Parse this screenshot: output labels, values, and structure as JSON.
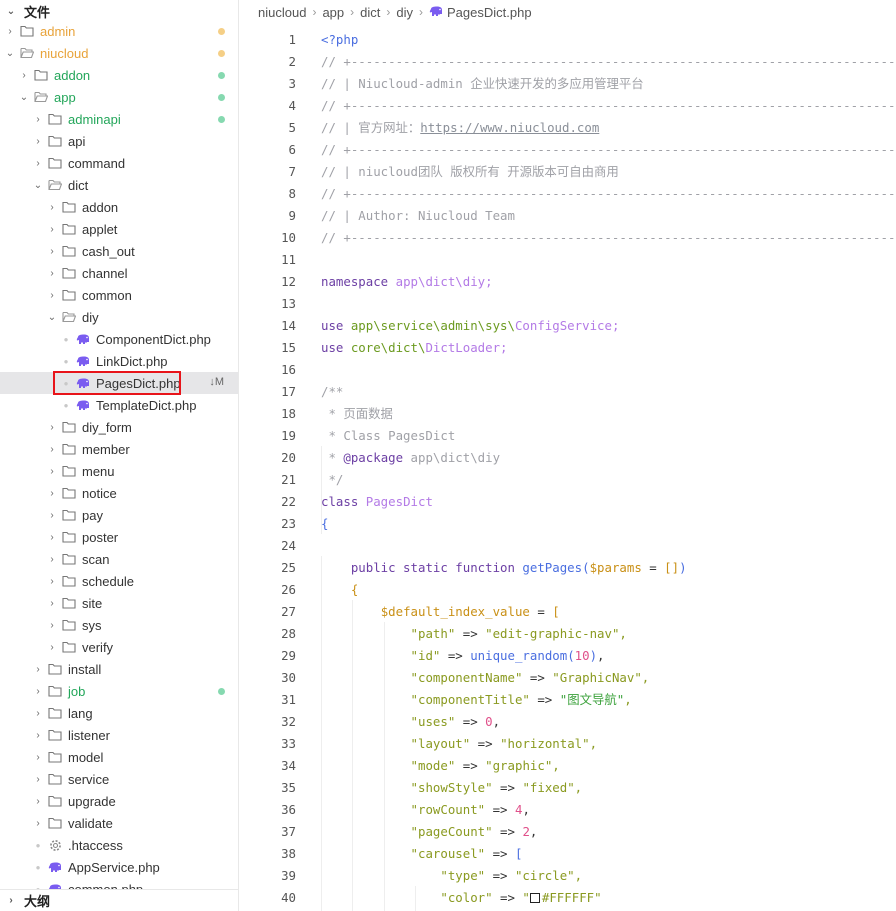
{
  "sidebar": {
    "files_header": "文件",
    "outline_header": "大纲",
    "tree": [
      {
        "name": "admin",
        "level": 0,
        "type": "folder",
        "open": false,
        "color": "#e8a33a",
        "dot": "#f5cf86"
      },
      {
        "name": "niucloud",
        "level": 0,
        "type": "folder",
        "open": true,
        "color": "#e8a33a",
        "dot": "#f5cf86"
      },
      {
        "name": "addon",
        "level": 1,
        "type": "folder",
        "open": false,
        "color": "#23a65a",
        "dot": "#86d9b0"
      },
      {
        "name": "app",
        "level": 1,
        "type": "folder",
        "open": true,
        "color": "#23a65a",
        "dot": "#86d9b0"
      },
      {
        "name": "adminapi",
        "level": 2,
        "type": "folder",
        "open": false,
        "color": "#23a65a",
        "dot": "#86d9b0"
      },
      {
        "name": "api",
        "level": 2,
        "type": "folder",
        "open": false
      },
      {
        "name": "command",
        "level": 2,
        "type": "folder",
        "open": false
      },
      {
        "name": "dict",
        "level": 2,
        "type": "folder",
        "open": true
      },
      {
        "name": "addon",
        "level": 3,
        "type": "folder",
        "open": false
      },
      {
        "name": "applet",
        "level": 3,
        "type": "folder",
        "open": false
      },
      {
        "name": "cash_out",
        "level": 3,
        "type": "folder",
        "open": false
      },
      {
        "name": "channel",
        "level": 3,
        "type": "folder",
        "open": false
      },
      {
        "name": "common",
        "level": 3,
        "type": "folder",
        "open": false
      },
      {
        "name": "diy",
        "level": 3,
        "type": "folder",
        "open": true
      },
      {
        "name": "ComponentDict.php",
        "level": 4,
        "type": "php"
      },
      {
        "name": "LinkDict.php",
        "level": 4,
        "type": "php"
      },
      {
        "name": "PagesDict.php",
        "level": 4,
        "type": "php",
        "selected": true,
        "badge": "↓M"
      },
      {
        "name": "TemplateDict.php",
        "level": 4,
        "type": "php"
      },
      {
        "name": "diy_form",
        "level": 3,
        "type": "folder",
        "open": false
      },
      {
        "name": "member",
        "level": 3,
        "type": "folder",
        "open": false
      },
      {
        "name": "menu",
        "level": 3,
        "type": "folder",
        "open": false
      },
      {
        "name": "notice",
        "level": 3,
        "type": "folder",
        "open": false
      },
      {
        "name": "pay",
        "level": 3,
        "type": "folder",
        "open": false
      },
      {
        "name": "poster",
        "level": 3,
        "type": "folder",
        "open": false
      },
      {
        "name": "scan",
        "level": 3,
        "type": "folder",
        "open": false
      },
      {
        "name": "schedule",
        "level": 3,
        "type": "folder",
        "open": false
      },
      {
        "name": "site",
        "level": 3,
        "type": "folder",
        "open": false
      },
      {
        "name": "sys",
        "level": 3,
        "type": "folder",
        "open": false
      },
      {
        "name": "verify",
        "level": 3,
        "type": "folder",
        "open": false
      },
      {
        "name": "install",
        "level": 2,
        "type": "folder",
        "open": false
      },
      {
        "name": "job",
        "level": 2,
        "type": "folder",
        "open": false,
        "color": "#23a65a",
        "dot": "#86d9b0"
      },
      {
        "name": "lang",
        "level": 2,
        "type": "folder",
        "open": false
      },
      {
        "name": "listener",
        "level": 2,
        "type": "folder",
        "open": false
      },
      {
        "name": "model",
        "level": 2,
        "type": "folder",
        "open": false
      },
      {
        "name": "service",
        "level": 2,
        "type": "folder",
        "open": false
      },
      {
        "name": "upgrade",
        "level": 2,
        "type": "folder",
        "open": false
      },
      {
        "name": "validate",
        "level": 2,
        "type": "folder",
        "open": false
      },
      {
        "name": ".htaccess",
        "level": 2,
        "type": "gear"
      },
      {
        "name": "AppService.php",
        "level": 2,
        "type": "php"
      },
      {
        "name": "common.php",
        "level": 2,
        "type": "php"
      }
    ]
  },
  "breadcrumb": [
    "niucloud",
    "app",
    "dict",
    "diy",
    "PagesDict.php"
  ],
  "code": [
    [
      [
        "f",
        "<?php"
      ]
    ],
    [
      [
        "c",
        "// +----------------------------------------------------------------------------------------------------"
      ]
    ],
    [
      [
        "c",
        "// | Niucloud-admin 企业快速开发的多应用管理平台"
      ]
    ],
    [
      [
        "c",
        "// +----------------------------------------------------------------------------------------------------"
      ]
    ],
    [
      [
        "c",
        "// | 官方网址："
      ],
      [
        "link",
        "https://www.niucloud.com"
      ]
    ],
    [
      [
        "c",
        "// +----------------------------------------------------------------------------------------------------"
      ]
    ],
    [
      [
        "c",
        "// | niucloud团队 版权所有 开源版本可自由商用"
      ]
    ],
    [
      [
        "c",
        "// +----------------------------------------------------------------------------------------------------"
      ]
    ],
    [
      [
        "c",
        "// | Author: Niucloud Team"
      ]
    ],
    [
      [
        "c",
        "// +----------------------------------------------------------------------------------------------------"
      ]
    ],
    [],
    [
      [
        "k",
        "namespace "
      ],
      [
        "ns",
        "app\\dict\\diy;"
      ]
    ],
    [],
    [
      [
        "k",
        "use "
      ],
      [
        "p",
        "app\\service\\admin\\sys\\"
      ],
      [
        "ns",
        "ConfigService;"
      ]
    ],
    [
      [
        "k",
        "use "
      ],
      [
        "p",
        "core\\dict\\"
      ],
      [
        "ns",
        "DictLoader;"
      ]
    ],
    [],
    [
      [
        "c",
        "/**"
      ]
    ],
    [
      [
        "c",
        " * 页面数据"
      ]
    ],
    [
      [
        "c",
        " * Class PagesDict"
      ]
    ],
    [
      [
        "c",
        " * "
      ],
      [
        "k",
        "@package"
      ],
      [
        "c",
        " app\\dict\\diy"
      ]
    ],
    [
      [
        "c",
        " */"
      ]
    ],
    [
      [
        "k",
        "class "
      ],
      [
        "ns",
        "PagesDict"
      ]
    ],
    [
      [
        "f",
        "{"
      ]
    ],
    [],
    [
      [
        "t",
        "    "
      ],
      [
        "k",
        "public static function "
      ],
      [
        "f",
        "getPages("
      ],
      [
        "v",
        "$params"
      ],
      [
        "t",
        " = "
      ],
      [
        "v",
        "[]"
      ],
      [
        "f",
        ")"
      ]
    ],
    [
      [
        "t",
        "    "
      ],
      [
        "v",
        "{"
      ]
    ],
    [
      [
        "t",
        "        "
      ],
      [
        "v",
        "$default_index_value"
      ],
      [
        "t",
        " = "
      ],
      [
        "v",
        "["
      ]
    ],
    [
      [
        "t",
        "            "
      ],
      [
        "s",
        "\"path\""
      ],
      [
        "t",
        " => "
      ],
      [
        "s",
        "\"edit-graphic-nav\","
      ]
    ],
    [
      [
        "t",
        "            "
      ],
      [
        "s",
        "\"id\""
      ],
      [
        "t",
        " => "
      ],
      [
        "f",
        "unique_random("
      ],
      [
        "n",
        "10"
      ],
      [
        "f",
        ")"
      ],
      [
        "t",
        ","
      ]
    ],
    [
      [
        "t",
        "            "
      ],
      [
        "s",
        "\"componentName\""
      ],
      [
        "t",
        " => "
      ],
      [
        "s",
        "\"GraphicNav\","
      ]
    ],
    [
      [
        "t",
        "            "
      ],
      [
        "s",
        "\"componentTitle\""
      ],
      [
        "t",
        " => "
      ],
      [
        "cn",
        "\"图文导航\""
      ],
      [
        "s",
        ","
      ]
    ],
    [
      [
        "t",
        "            "
      ],
      [
        "s",
        "\"uses\""
      ],
      [
        "t",
        " => "
      ],
      [
        "n",
        "0"
      ],
      [
        "t",
        ","
      ]
    ],
    [
      [
        "t",
        "            "
      ],
      [
        "s",
        "\"layout\""
      ],
      [
        "t",
        " => "
      ],
      [
        "s",
        "\"horizontal\","
      ]
    ],
    [
      [
        "t",
        "            "
      ],
      [
        "s",
        "\"mode\""
      ],
      [
        "t",
        " => "
      ],
      [
        "s",
        "\"graphic\","
      ]
    ],
    [
      [
        "t",
        "            "
      ],
      [
        "s",
        "\"showStyle\""
      ],
      [
        "t",
        " => "
      ],
      [
        "s",
        "\"fixed\","
      ]
    ],
    [
      [
        "t",
        "            "
      ],
      [
        "s",
        "\"rowCount\""
      ],
      [
        "t",
        " => "
      ],
      [
        "n",
        "4"
      ],
      [
        "t",
        ","
      ]
    ],
    [
      [
        "t",
        "            "
      ],
      [
        "s",
        "\"pageCount\""
      ],
      [
        "t",
        " => "
      ],
      [
        "n",
        "2"
      ],
      [
        "t",
        ","
      ]
    ],
    [
      [
        "t",
        "            "
      ],
      [
        "s",
        "\"carousel\""
      ],
      [
        "t",
        " => "
      ],
      [
        "f",
        "["
      ]
    ],
    [
      [
        "t",
        "                "
      ],
      [
        "s",
        "\"type\""
      ],
      [
        "t",
        " => "
      ],
      [
        "s",
        "\"circle\","
      ]
    ],
    [
      [
        "t",
        "                "
      ],
      [
        "s",
        "\"color\""
      ],
      [
        "t",
        " => "
      ],
      [
        "s",
        "\""
      ],
      [
        "swatch",
        "#FFFFFF"
      ],
      [
        "s",
        "#FFFFFF\""
      ]
    ]
  ]
}
